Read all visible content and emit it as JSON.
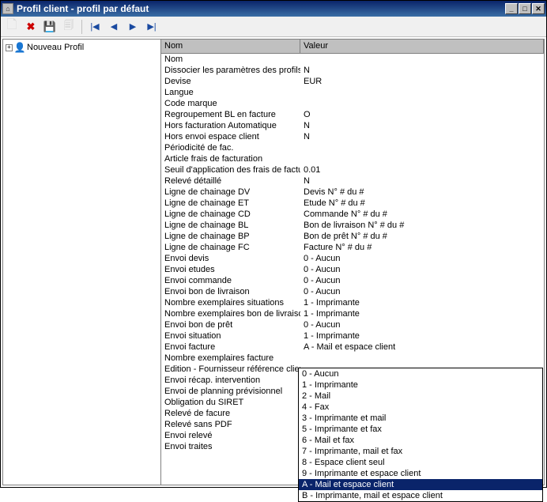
{
  "window": {
    "title": "Profil client - profil par défaut"
  },
  "tree": {
    "root": "Nouveau Profil"
  },
  "grid": {
    "headers": {
      "nom": "Nom",
      "valeur": "Valeur"
    },
    "rows": [
      {
        "nom": "Nom",
        "val": ""
      },
      {
        "nom": "Dissocier les paramètres des profils",
        "val": "N"
      },
      {
        "nom": "Devise",
        "val": "EUR"
      },
      {
        "nom": "Langue",
        "val": ""
      },
      {
        "nom": "Code marque",
        "val": ""
      },
      {
        "nom": "Regroupement BL en facture",
        "val": "O"
      },
      {
        "nom": "Hors facturation Automatique",
        "val": "N"
      },
      {
        "nom": "Hors envoi espace client",
        "val": "N"
      },
      {
        "nom": "Périodicité de fac.",
        "val": ""
      },
      {
        "nom": "Article frais de facturation",
        "val": ""
      },
      {
        "nom": "Seuil d'application des frais de factur",
        "val": "0.01"
      },
      {
        "nom": "Relevé détaillé",
        "val": "N"
      },
      {
        "nom": "Ligne de chainage DV",
        "val": "Devis N° #  du #"
      },
      {
        "nom": "Ligne de chainage ET",
        "val": "Etude N° #  du #"
      },
      {
        "nom": "Ligne de chainage CD",
        "val": "Commande N° #  du #"
      },
      {
        "nom": "Ligne de chainage BL",
        "val": "Bon de livraison N° #  du #"
      },
      {
        "nom": "Ligne de chainage BP",
        "val": "Bon de prêt N° #  du #"
      },
      {
        "nom": "Ligne de chainage FC",
        "val": "Facture N° #  du #"
      },
      {
        "nom": "Envoi devis",
        "val": "0 - Aucun"
      },
      {
        "nom": "Envoi etudes",
        "val": "0 - Aucun"
      },
      {
        "nom": "Envoi commande",
        "val": "0 - Aucun"
      },
      {
        "nom": "Envoi bon de livraison",
        "val": "0 - Aucun"
      },
      {
        "nom": "Nombre exemplaires situations",
        "val": "1 - Imprimante"
      },
      {
        "nom": "Nombre exemplaires bon de livraison",
        "val": "1 - Imprimante"
      },
      {
        "nom": "Envoi bon de prêt",
        "val": "0 - Aucun"
      },
      {
        "nom": "Envoi situation",
        "val": "1 - Imprimante"
      },
      {
        "nom": "Envoi facture",
        "val": "A - Mail et espace client"
      },
      {
        "nom": "Nombre exemplaires facture",
        "val": ""
      },
      {
        "nom": "Edition - Fournisseur référence client",
        "val": ""
      },
      {
        "nom": "Envoi récap. intervention",
        "val": ""
      },
      {
        "nom": "Envoi de planning prévisionnel",
        "val": ""
      },
      {
        "nom": "Obligation du SIRET",
        "val": ""
      },
      {
        "nom": "Relevé de facure",
        "val": ""
      },
      {
        "nom": "Relevé sans PDF",
        "val": ""
      },
      {
        "nom": "Envoi relevé",
        "val": ""
      },
      {
        "nom": "Envoi traites",
        "val": ""
      }
    ]
  },
  "dropdown": {
    "options": [
      "0 - Aucun",
      "1 - Imprimante",
      "2 - Mail",
      "4 - Fax",
      "3 - Imprimante et mail",
      "5 - Imprimante et fax",
      "6 - Mail et fax",
      "7 - Imprimante, mail et fax",
      "8 - Espace client seul",
      "9 - Imprimante et espace client",
      "A - Mail et espace client",
      "B - Imprimante, mail et espace client"
    ],
    "selected_index": 10
  }
}
